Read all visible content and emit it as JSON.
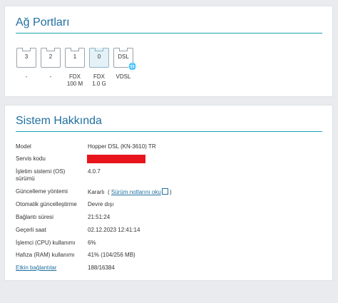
{
  "ports_card": {
    "title": "Ağ Portları",
    "ports": [
      {
        "number": "3",
        "caption1": "-",
        "caption2": ""
      },
      {
        "number": "2",
        "caption1": "-",
        "caption2": ""
      },
      {
        "number": "1",
        "caption1": "FDX",
        "caption2": "100 M"
      },
      {
        "number": "0",
        "caption1": "FDX",
        "caption2": "1.0 G"
      },
      {
        "number": "DSL",
        "caption1": "VDSL",
        "caption2": ""
      }
    ]
  },
  "system_card": {
    "title": "Sistem Hakkında",
    "rows": [
      {
        "label": "Model",
        "value": "Hopper DSL (KN-3610) TR"
      },
      {
        "label": "Servis kodu",
        "value": ""
      },
      {
        "label": "İşletim sistemi (OS) sürümü",
        "value": "4.0.7"
      },
      {
        "label": "Güncelleme yöntemi",
        "value": "Kararlı",
        "link": "Sürüm notlarını oku",
        "paren_open": "(",
        "paren_close": ")"
      },
      {
        "label": "Otomatik güncelleştirme",
        "value": "Devre dışı"
      },
      {
        "label": "Bağlantı süresi",
        "value": "21:51:24"
      },
      {
        "label": "Geçerli saat",
        "value": "02.12.2023 12:41:14"
      },
      {
        "label": "İşlemci (CPU) kullanımı",
        "value": "6%"
      },
      {
        "label": "Hafıza (RAM) kullanımı",
        "value": "41% (104/256 MB)"
      },
      {
        "label": "Etkin bağlantılar",
        "value": "188/16384"
      }
    ]
  },
  "colors": {
    "accent": "#1f6fa0",
    "title_line": "#1aa3b5",
    "active_port": "#e4f1f6",
    "redaction": "#e8141c"
  }
}
